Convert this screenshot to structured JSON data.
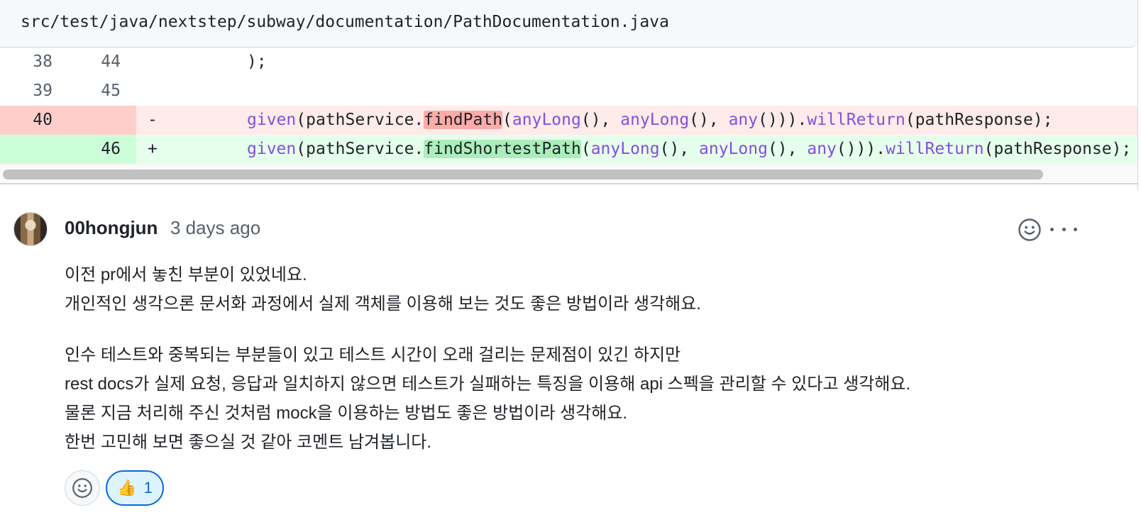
{
  "file": {
    "path": "src/test/java/nextstep/subway/documentation/PathDocumentation.java"
  },
  "diff": {
    "rows": [
      {
        "old": "38",
        "new": "44",
        "marker": "",
        "type": "context",
        "code": ");"
      },
      {
        "old": "39",
        "new": "45",
        "marker": "",
        "type": "context",
        "code": ""
      },
      {
        "old": "40",
        "new": "",
        "marker": "-",
        "type": "del",
        "parts": {
          "given": "given",
          "a": "(pathService.",
          "method": "findPath",
          "b": "(",
          "anyLong1": "anyLong",
          "c": "(), ",
          "anyLong2": "anyLong",
          "d": "(), ",
          "any": "any",
          "e": "())).",
          "willReturn": "willReturn",
          "f": "(pathResponse);"
        }
      },
      {
        "old": "",
        "new": "46",
        "marker": "+",
        "type": "add",
        "parts": {
          "given": "given",
          "a": "(pathService.",
          "method": "findShortestPath",
          "b": "(",
          "anyLong1": "anyLong",
          "c": "(), ",
          "anyLong2": "anyLong",
          "d": "(), ",
          "any": "any",
          "e": "())).",
          "willReturn": "willReturn",
          "f": "(pathResponse);"
        }
      }
    ]
  },
  "comment": {
    "author": "00hongjun",
    "time": "3 days ago",
    "avatar_icon": "user-avatar-photo",
    "paragraphs": [
      [
        "이전 pr에서 놓친 부분이 있었네요.",
        "개인적인 생각으론 문서화 과정에서 실제 객체를 이용해 보는 것도 좋은 방법이라 생각해요."
      ],
      [
        "인수 테스트와 중복되는 부분들이 있고 테스트 시간이 오래 걸리는 문제점이 있긴 하지만",
        "rest docs가 실제 요청, 응답과 일치하지 않으면 테스트가 실패하는 특징을 이용해 api 스펙을 관리할 수 있다고 생각해요.",
        "물론 지금 처리해 주신 것처럼 mock을 이용하는 방법도 좋은 방법이라 생각해요.",
        "한번 고민해 보면 좋으실 것 같아 코멘트 남겨봅니다."
      ]
    ],
    "reactions": {
      "add_icon": "smiley-icon",
      "thumbs_emoji": "👍",
      "thumbs_count": "1"
    }
  },
  "colors": {
    "accent": "#0969da",
    "del_bg": "#ffebe9",
    "add_bg": "#e6ffec",
    "function": "#8250df"
  }
}
